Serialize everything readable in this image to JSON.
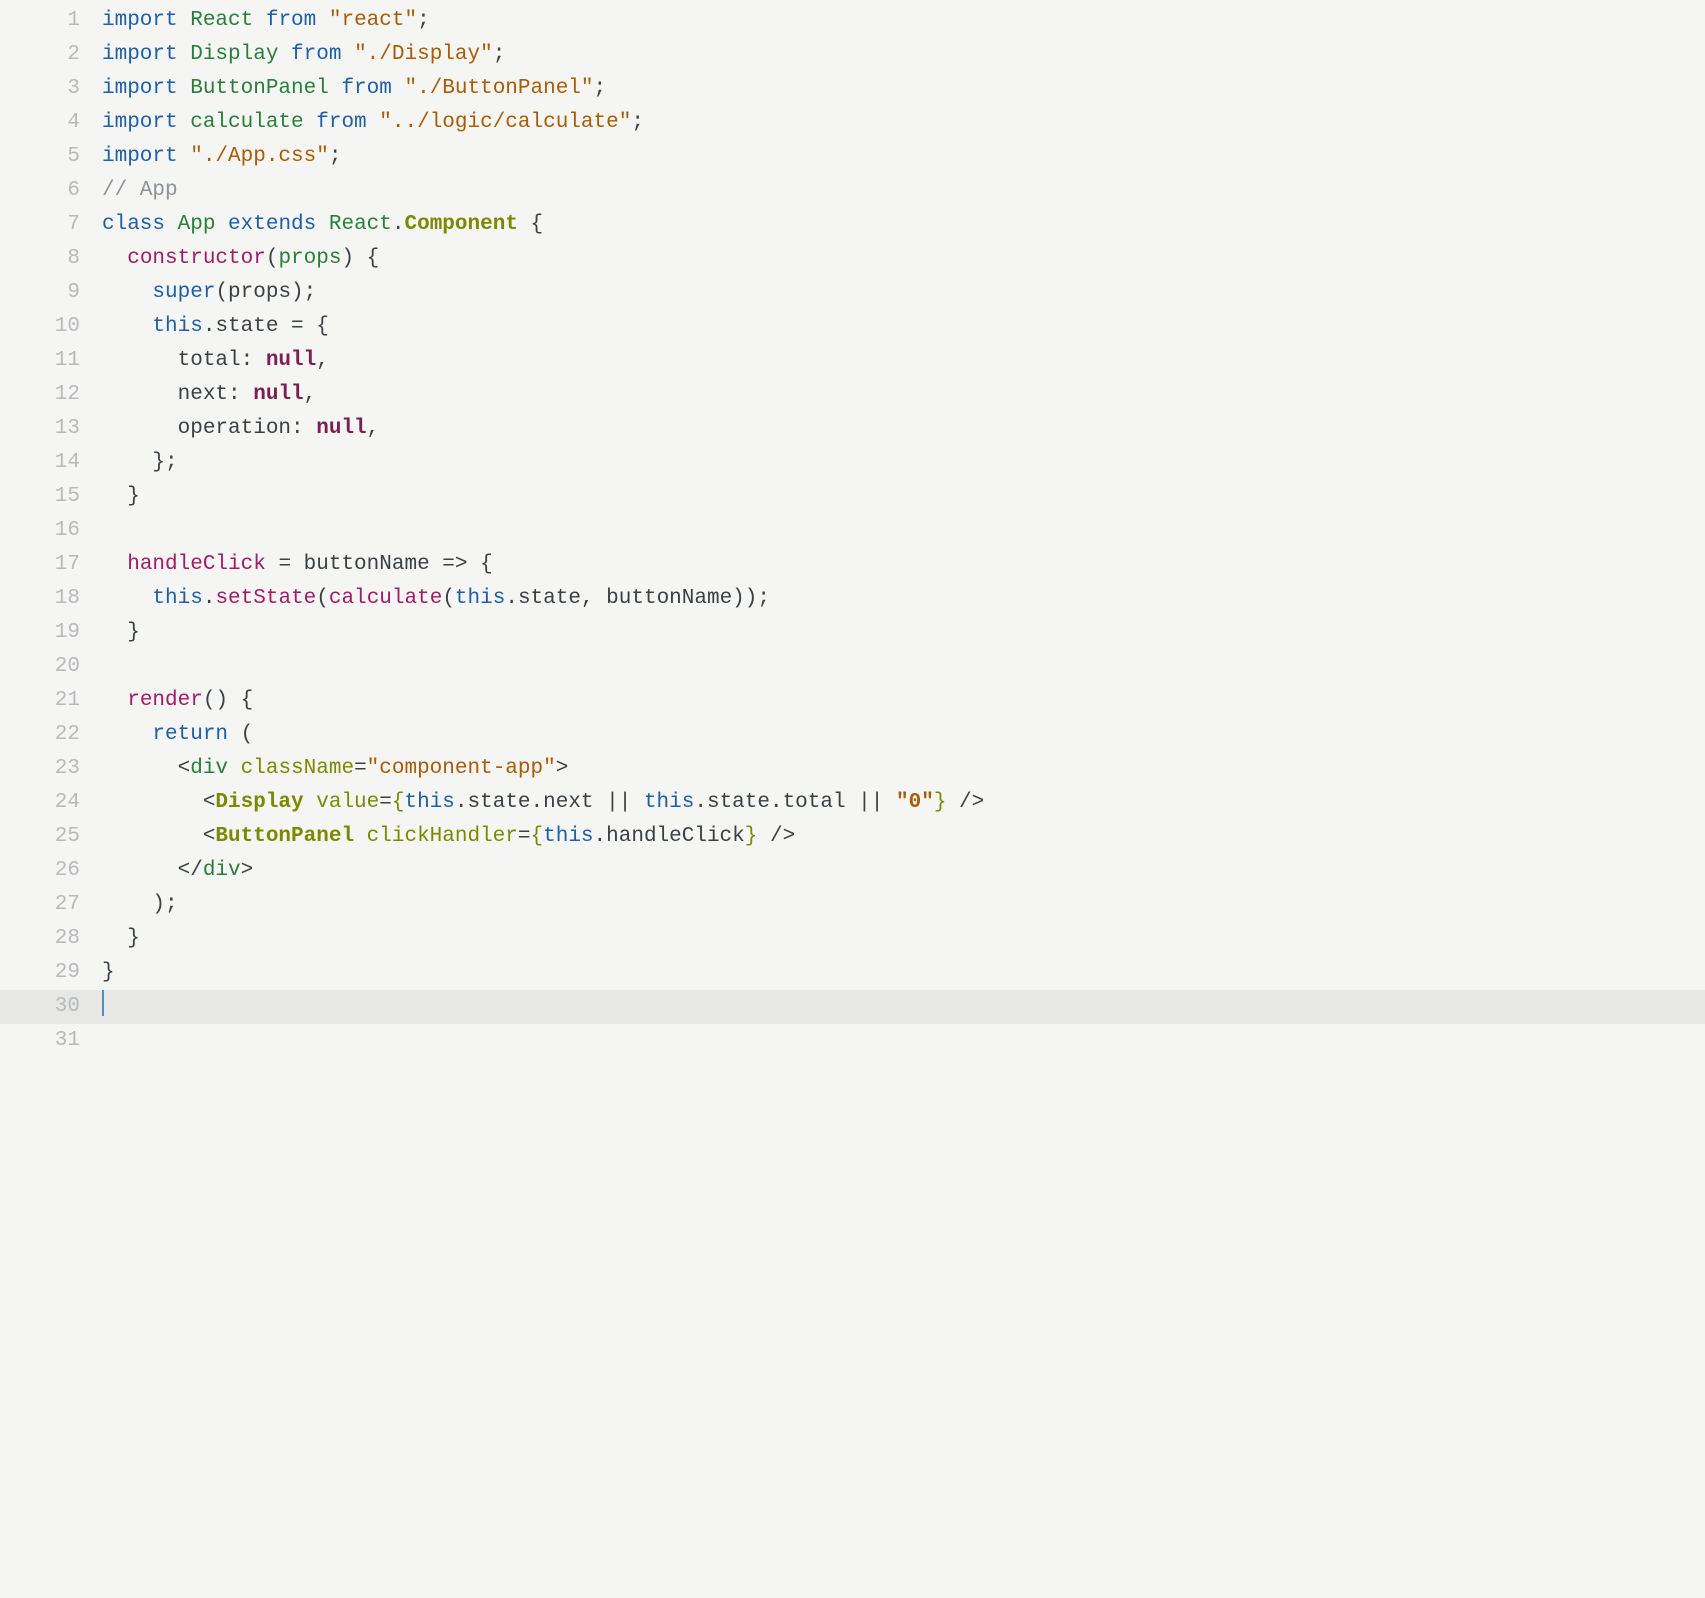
{
  "editor": {
    "gutter": [
      "1",
      "2",
      "3",
      "4",
      "5",
      "6",
      "7",
      "8",
      "9",
      "10",
      "11",
      "12",
      "13",
      "14",
      "15",
      "16",
      "17",
      "18",
      "19",
      "20",
      "21",
      "22",
      "23",
      "24",
      "25",
      "26",
      "27",
      "28",
      "29",
      "30",
      "31"
    ],
    "active_line_index": 29,
    "lines": [
      [
        [
          "import ",
          "kw"
        ],
        [
          "React",
          "def"
        ],
        [
          " ",
          ""
        ],
        [
          "from",
          "kw"
        ],
        [
          " ",
          ""
        ],
        [
          "\"react\"",
          "str"
        ],
        [
          ";",
          ""
        ]
      ],
      [
        [
          "import ",
          "kw"
        ],
        [
          "Display",
          "def"
        ],
        [
          " ",
          ""
        ],
        [
          "from",
          "kw"
        ],
        [
          " ",
          ""
        ],
        [
          "\"./Display\"",
          "str"
        ],
        [
          ";",
          ""
        ]
      ],
      [
        [
          "import ",
          "kw"
        ],
        [
          "ButtonPanel",
          "def"
        ],
        [
          " ",
          ""
        ],
        [
          "from",
          "kw"
        ],
        [
          " ",
          ""
        ],
        [
          "\"./ButtonPanel\"",
          "str"
        ],
        [
          ";",
          ""
        ]
      ],
      [
        [
          "import ",
          "kw"
        ],
        [
          "calculate",
          "def"
        ],
        [
          " ",
          ""
        ],
        [
          "from",
          "kw"
        ],
        [
          " ",
          ""
        ],
        [
          "\"../logic/calculate\"",
          "str"
        ],
        [
          ";",
          ""
        ]
      ],
      [
        [
          "import ",
          "kw"
        ],
        [
          "\"./App.css\"",
          "str"
        ],
        [
          ";",
          ""
        ]
      ],
      [
        [
          "// App",
          "comment"
        ]
      ],
      [
        [
          "class ",
          "kw"
        ],
        [
          "App",
          "def"
        ],
        [
          " ",
          ""
        ],
        [
          "extends",
          "kw"
        ],
        [
          " ",
          ""
        ],
        [
          "React",
          "def"
        ],
        [
          ".",
          ""
        ],
        [
          "Component",
          "compmethod"
        ],
        [
          " {",
          ""
        ]
      ],
      [
        [
          "  ",
          ""
        ],
        [
          "constructor",
          "method"
        ],
        [
          "(",
          ""
        ],
        [
          "props",
          "def"
        ],
        [
          ") {",
          ""
        ]
      ],
      [
        [
          "    ",
          ""
        ],
        [
          "super",
          "kw"
        ],
        [
          "(props);",
          ""
        ]
      ],
      [
        [
          "    ",
          ""
        ],
        [
          "this",
          "kw"
        ],
        [
          ".state = {",
          ""
        ]
      ],
      [
        [
          "      total: ",
          ""
        ],
        [
          "null",
          "null"
        ],
        [
          ",",
          ""
        ]
      ],
      [
        [
          "      next: ",
          ""
        ],
        [
          "null",
          "null"
        ],
        [
          ",",
          ""
        ]
      ],
      [
        [
          "      operation: ",
          ""
        ],
        [
          "null",
          "null"
        ],
        [
          ",",
          ""
        ]
      ],
      [
        [
          "    };",
          ""
        ]
      ],
      [
        [
          "  }",
          ""
        ]
      ],
      [
        [
          "",
          ""
        ]
      ],
      [
        [
          "  ",
          ""
        ],
        [
          "handleClick",
          "method"
        ],
        [
          " = buttonName ",
          ""
        ],
        [
          "=>",
          "arrow"
        ],
        [
          " {",
          ""
        ]
      ],
      [
        [
          "    ",
          ""
        ],
        [
          "this",
          "kw"
        ],
        [
          ".",
          ""
        ],
        [
          "setState",
          "method"
        ],
        [
          "(",
          ""
        ],
        [
          "calculate",
          "method"
        ],
        [
          "(",
          ""
        ],
        [
          "this",
          "kw"
        ],
        [
          ".state, buttonName));",
          ""
        ]
      ],
      [
        [
          "  }",
          ""
        ]
      ],
      [
        [
          "",
          ""
        ]
      ],
      [
        [
          "  ",
          ""
        ],
        [
          "render",
          "method"
        ],
        [
          "() {",
          ""
        ]
      ],
      [
        [
          "    ",
          ""
        ],
        [
          "return",
          "kw"
        ],
        [
          " (",
          ""
        ]
      ],
      [
        [
          "      <",
          ""
        ],
        [
          "div",
          "tag"
        ],
        [
          " ",
          ""
        ],
        [
          "className",
          "attr"
        ],
        [
          "=",
          ""
        ],
        [
          "\"component-app\"",
          "str"
        ],
        [
          ">",
          ""
        ]
      ],
      [
        [
          "        <",
          ""
        ],
        [
          "Display",
          "component"
        ],
        [
          " ",
          ""
        ],
        [
          "value",
          "attr"
        ],
        [
          "=",
          ""
        ],
        [
          "{",
          "brace"
        ],
        [
          "this",
          "kw"
        ],
        [
          ".state.next || ",
          ""
        ],
        [
          "this",
          "kw"
        ],
        [
          ".state.total || ",
          ""
        ],
        [
          "\"0\"",
          "strjsx"
        ],
        [
          "}",
          "brace"
        ],
        [
          " />",
          ""
        ]
      ],
      [
        [
          "        <",
          ""
        ],
        [
          "ButtonPanel",
          "component"
        ],
        [
          " ",
          ""
        ],
        [
          "clickHandler",
          "attr"
        ],
        [
          "=",
          ""
        ],
        [
          "{",
          "brace"
        ],
        [
          "this",
          "kw"
        ],
        [
          ".handleClick",
          ""
        ],
        [
          "}",
          "brace"
        ],
        [
          " />",
          ""
        ]
      ],
      [
        [
          "      </",
          ""
        ],
        [
          "div",
          "tag"
        ],
        [
          ">",
          ""
        ]
      ],
      [
        [
          "    );",
          ""
        ]
      ],
      [
        [
          "  }",
          ""
        ]
      ],
      [
        [
          "}",
          ""
        ]
      ],
      [
        [
          "",
          ""
        ]
      ],
      [
        [
          "",
          ""
        ]
      ]
    ]
  }
}
